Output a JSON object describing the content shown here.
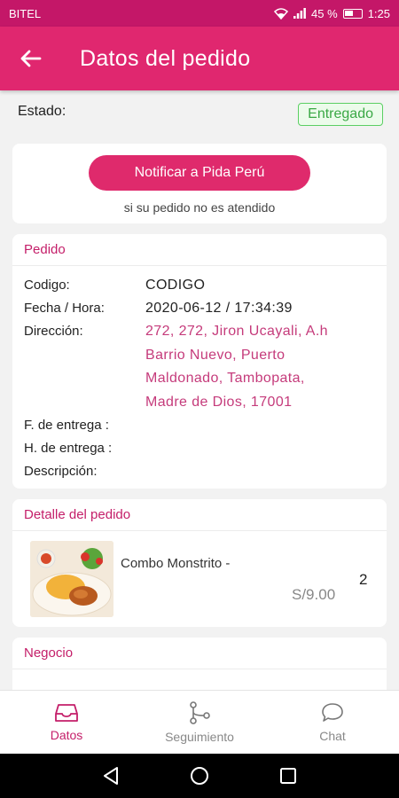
{
  "status_bar": {
    "carrier": "BITEL",
    "battery": "45 %",
    "time": "1:25"
  },
  "app_bar": {
    "title": "Datos del pedido"
  },
  "estado": {
    "label": "Estado:",
    "value": "Entregado"
  },
  "notify": {
    "button_label": "Notificar a Pida Perú",
    "subtext": "si su pedido no es atendido"
  },
  "pedido": {
    "title": "Pedido",
    "rows": [
      {
        "label": "Codigo:",
        "value": "CODIGO"
      },
      {
        "label": "Fecha / Hora:",
        "value": "2020-06-12 / 17:34:39"
      },
      {
        "label": "Dirección:",
        "value_lines": [
          "272, 272, Jiron Ucayali, A.h",
          "Barrio Nuevo, Puerto",
          "Maldonado, Tambopata,",
          "Madre de Dios, 17001"
        ]
      },
      {
        "label": "F. de entrega :",
        "value": ""
      },
      {
        "label": "H. de entrega :",
        "value": ""
      },
      {
        "label": "Descripción:",
        "value": ""
      }
    ]
  },
  "detalle": {
    "title": "Detalle del pedido",
    "item": {
      "name": "Combo Monstrito -",
      "price": "S/9.00",
      "quantity": "2"
    }
  },
  "negocio": {
    "title": "Negocio"
  },
  "bottom_nav": [
    {
      "label": "Datos",
      "icon": "inbox-icon",
      "active": true
    },
    {
      "label": "Seguimiento",
      "icon": "route-icon",
      "active": false
    },
    {
      "label": "Chat",
      "icon": "chat-icon",
      "active": false
    }
  ],
  "colors": {
    "primary": "#e0276f",
    "status_bar": "#c41768",
    "accent_text": "#c41e69",
    "success": "#3aa845"
  }
}
